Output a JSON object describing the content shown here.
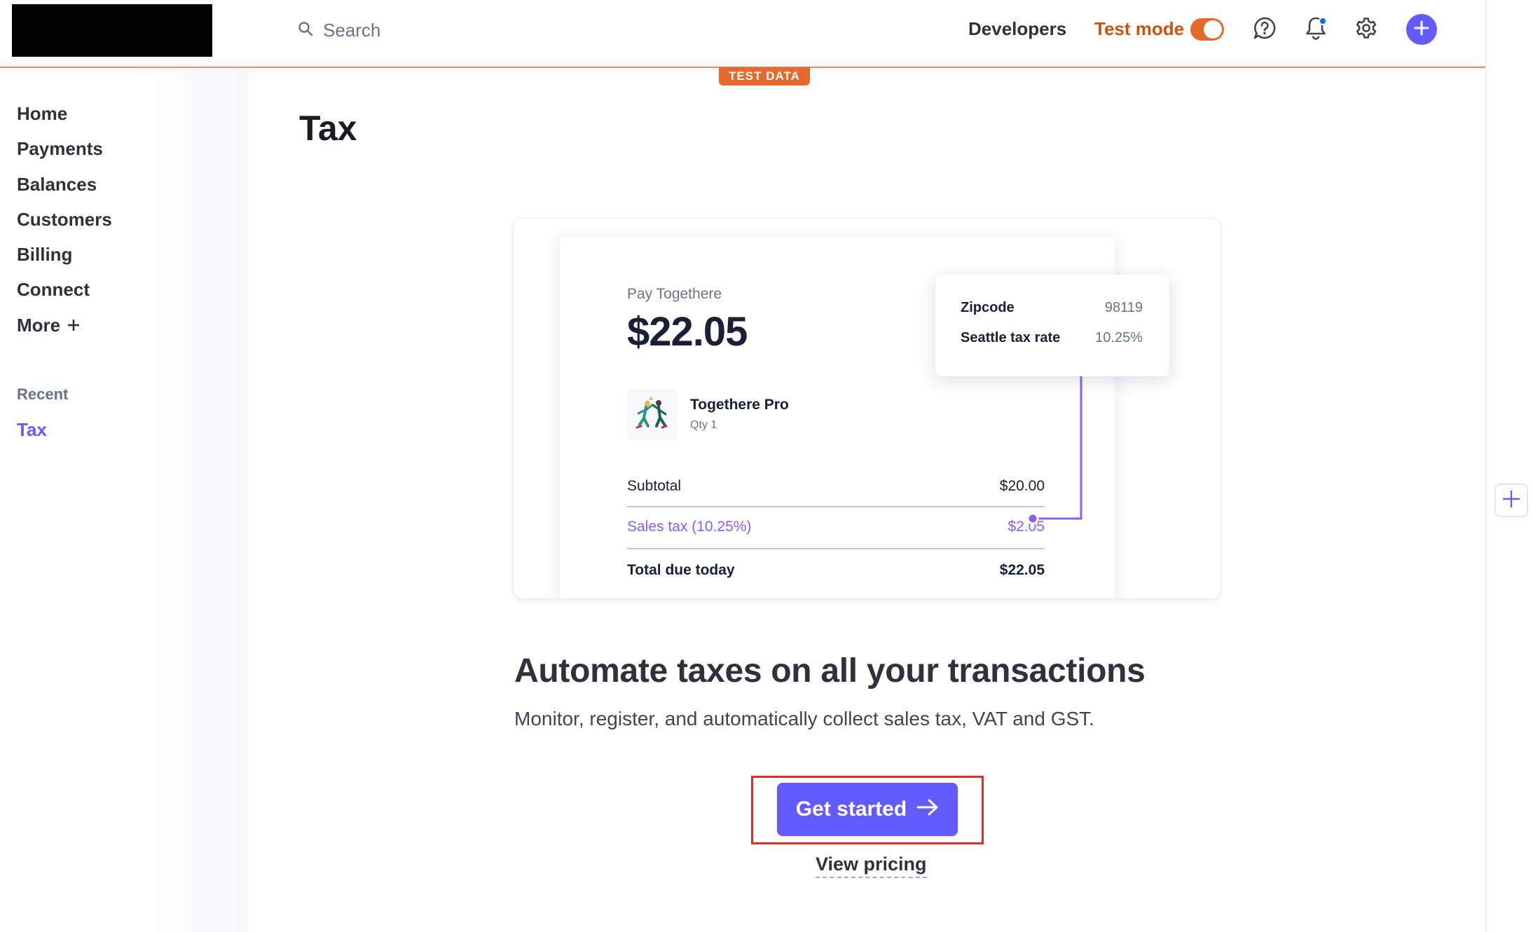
{
  "header": {
    "search_placeholder": "Search",
    "developers_label": "Developers",
    "test_mode_label": "Test mode",
    "test_mode_on": true,
    "test_data_badge": "TEST DATA",
    "icons": [
      "search-icon",
      "help-icon",
      "bell-icon",
      "gear-icon",
      "plus-icon"
    ],
    "accent_color": "#635bff",
    "test_mode_color": "#e4692d"
  },
  "sidebar": {
    "items": [
      {
        "label": "Home"
      },
      {
        "label": "Payments"
      },
      {
        "label": "Balances"
      },
      {
        "label": "Customers"
      },
      {
        "label": "Billing"
      },
      {
        "label": "Connect"
      },
      {
        "label": "More",
        "icon": "plus-icon"
      }
    ],
    "recent_label": "Recent",
    "recent_items": [
      {
        "label": "Tax",
        "active": true
      }
    ]
  },
  "main": {
    "title": "Tax",
    "preview": {
      "pay_to": "Pay Togethere",
      "amount": "$22.05",
      "product_name": "Togethere Pro",
      "product_qty": "Qty 1",
      "subtotal_label": "Subtotal",
      "subtotal_value": "$20.00",
      "tax_label": "Sales tax (10.25%)",
      "tax_value": "$2.05",
      "total_label": "Total due today",
      "total_value": "$22.05",
      "popover": {
        "zip_label": "Zipcode",
        "zip_value": "98119",
        "rate_label": "Seattle tax rate",
        "rate_value": "10.25%"
      }
    },
    "headline": "Automate taxes on all your transactions",
    "subline": "Monitor, register, and automatically collect sales tax, VAT and GST.",
    "cta_label": "Get started",
    "pricing_link": "View pricing"
  }
}
